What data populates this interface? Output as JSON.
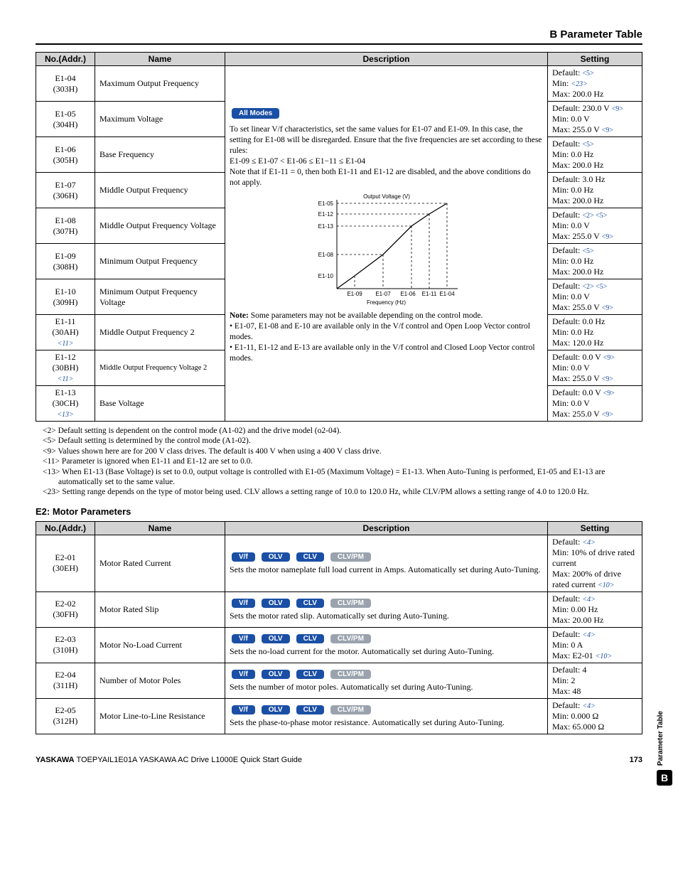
{
  "header": "B  Parameter Table",
  "columns": {
    "c1": "No.(Addr.)",
    "c2": "Name",
    "c3": "Description",
    "c4": "Setting"
  },
  "t1_rows": [
    {
      "addr1": "E1-04",
      "addr2": "(303H)",
      "name": "Maximum Output Frequency",
      "s1": "Default: ",
      "r1": "<5>",
      "s2": "Min: ",
      "r2": "<23>",
      "s3": "Max: 200.0 Hz"
    },
    {
      "addr1": "E1-05",
      "addr2": "(304H)",
      "name": "Maximum Voltage",
      "s1": "Default: 230.0 V ",
      "r1": "<9>",
      "s2": "Min: 0.0 V",
      "s3": "Max: 255.0 V ",
      "r3": "<9>"
    },
    {
      "addr1": "E1-06",
      "addr2": "(305H)",
      "name": "Base Frequency",
      "s1": "Default: ",
      "r1": "<5>",
      "s2": "Min: 0.0 Hz",
      "s3": "Max: 200.0 Hz"
    },
    {
      "addr1": "E1-07",
      "addr2": "(306H)",
      "name": "Middle Output Frequency",
      "s1": "Default: 3.0 Hz",
      "s2": "Min: 0.0 Hz",
      "s3": "Max: 200.0 Hz"
    },
    {
      "addr1": "E1-08",
      "addr2": "(307H)",
      "name": "Middle Output Frequency Voltage",
      "s1": "Default: ",
      "r1": "<2> <5>",
      "s2": "Min: 0.0 V",
      "s3": "Max: 255.0 V ",
      "r3": "<9>"
    },
    {
      "addr1": "E1-09",
      "addr2": "(308H)",
      "name": "Minimum Output Frequency",
      "s1": "Default: ",
      "r1": "<5>",
      "s2": "Min: 0.0 Hz",
      "s3": "Max: 200.0 Hz"
    },
    {
      "addr1": "E1-10",
      "addr2": "(309H)",
      "name": "Minimum Output Frequency Voltage",
      "s1": "Default: ",
      "r1": "<2> <5>",
      "s2": "Min: 0.0 V",
      "s3": "Max: 255.0 V ",
      "r3": "<9>"
    },
    {
      "addr1": "E1-11",
      "addr2": "(30AH)",
      "addr_ref": "<11>",
      "name": "Middle Output Frequency 2",
      "s1": "Default: 0.0 Hz",
      "s2": "Min: 0.0 Hz",
      "s3": "Max: 120.0 Hz"
    },
    {
      "addr1": "E1-12",
      "addr2": "(30BH)",
      "addr_ref": "<11>",
      "name": "Middle Output Frequency Voltage 2",
      "s1": "Default: 0.0 V ",
      "r1": "<9>",
      "s2": "Min: 0.0 V",
      "s3": "Max: 255.0 V ",
      "r3": "<9>"
    },
    {
      "addr1": "E1-13",
      "addr2": "(30CH)",
      "addr_ref": "<13>",
      "name": "Base Voltage",
      "s1": "Default: 0.0 V ",
      "r1": "<9>",
      "s2": "Min: 0.0 V",
      "s3": "Max: 255.0 V ",
      "r3": "<9>"
    }
  ],
  "desc": {
    "badge": "All Modes",
    "p1": "To set linear V/f characteristics, set the same values for E1-07 and E1-09. In this case, the setting for E1-08 will be disregarded. Ensure that the five frequencies are set according to these rules:",
    "eq": "E1-09 ≤ E1-07 < E1-06 ≤ E1−11 ≤ E1-04",
    "p2": "Note that if E1-11 = 0, then both E1-11 and E1-12 are disabled, and the above conditions do not apply.",
    "diag_title": "Output Voltage (V)",
    "diag_y": [
      "E1-05",
      "E1-12",
      "E1-13",
      "E1-08",
      "E1-10"
    ],
    "diag_x": [
      "E1-09",
      "E1-07",
      "E1-06",
      "E1-11",
      "E1-04"
    ],
    "diag_xlabel": "Frequency (Hz)",
    "note_word": "Note:",
    "note_text": " Some parameters may not be available depending on the control mode.",
    "bul1": "E1-07, E1-08 and E-10 are available only in the V/f control and Open Loop Vector control modes.",
    "bul2": "E1-11, E1-12 and E-13 are available only in the V/f control and Closed Loop Vector control modes."
  },
  "footnotes": {
    "f2": "<2> Default setting is dependent on the control mode (A1-02) and the drive model (o2-04).",
    "f5": "<5> Default setting is determined by the control mode (A1-02).",
    "f9": "<9> Values shown here are for 200 V class drives. The default is 400 V when using a 400 V class drive.",
    "f11": "<11> Parameter is ignored when E1-11 and E1-12 are set to 0.0.",
    "f13": "<13> When E1-13 (Base Voltage) is set to 0.0, output voltage is controlled with E1-05 (Maximum Voltage) = E1-13. When Auto-Tuning is performed, E1-05 and E1-13 are automatically set to the same value.",
    "f23": "<23> Setting range depends on the type of motor being used. CLV allows a setting range of 10.0 to 120.0 Hz, while CLV/PM allows a setting range of 4.0 to 120.0 Hz."
  },
  "section2": "E2: Motor Parameters",
  "badges": {
    "vf": "V/f",
    "olv": "OLV",
    "clv": "CLV",
    "clvpm": "CLV/PM"
  },
  "t2_rows": [
    {
      "addr1": "E2-01",
      "addr2": "(30EH)",
      "name": "Motor Rated Current",
      "text": "Sets the motor nameplate full load current in Amps. Automatically set during Auto-Tuning.",
      "s1": "Default: ",
      "r1": "<4>",
      "s2": "Min: 10% of drive rated current",
      "s3": "Max: 200% of drive rated current ",
      "r3": "<10>"
    },
    {
      "addr1": "E2-02",
      "addr2": "(30FH)",
      "name": "Motor Rated Slip",
      "text": "Sets the motor rated slip. Automatically set during Auto-Tuning.",
      "s1": "Default: ",
      "r1": "<4>",
      "s2": "Min: 0.00 Hz",
      "s3": "Max: 20.00 Hz"
    },
    {
      "addr1": "E2-03",
      "addr2": "(310H)",
      "name": "Motor No-Load Current",
      "text": "Sets the no-load current for the motor. Automatically set during Auto-Tuning.",
      "s1": "Default: ",
      "r1": "<4>",
      "s2": "Min: 0 A",
      "s3": "Max: E2-01 ",
      "r3": "<10>"
    },
    {
      "addr1": "E2-04",
      "addr2": "(311H)",
      "name": "Number of Motor Poles",
      "text": "Sets the number of motor poles. Automatically set during Auto-Tuning.",
      "s1": "Default: 4",
      "s2": "Min: 2",
      "s3": "Max: 48"
    },
    {
      "addr1": "E2-05",
      "addr2": "(312H)",
      "name": "Motor Line-to-Line Resistance",
      "text": "Sets the phase-to-phase motor resistance. Automatically set during Auto-Tuning.",
      "s1": "Default: ",
      "r1": "<4>",
      "s2": "Min: 0.000 Ω",
      "s3": "Max: 65.000 Ω"
    }
  ],
  "footer": {
    "left": "YASKAWA",
    "mid": " TOEPYAIL1E01A YASKAWA AC Drive L1000E Quick Start Guide",
    "page": "173"
  },
  "side": {
    "label": "Parameter Table",
    "letter": "B"
  },
  "chart_data": {
    "type": "line",
    "title": "Output Voltage (V)",
    "xlabel": "Frequency (Hz)",
    "ylabel": "Output Voltage (V)",
    "x_points": [
      "E1-09",
      "E1-07",
      "E1-06",
      "E1-11",
      "E1-04"
    ],
    "y_levels": [
      "E1-10",
      "E1-08",
      "E1-13",
      "E1-12",
      "E1-05"
    ],
    "series": [
      {
        "name": "V/f pattern",
        "points": [
          {
            "x": "E1-09",
            "y": "E1-10"
          },
          {
            "x": "E1-07",
            "y": "E1-08"
          },
          {
            "x": "E1-06",
            "y": "E1-13"
          },
          {
            "x": "E1-11",
            "y": "E1-12"
          },
          {
            "x": "E1-04",
            "y": "E1-05"
          }
        ]
      }
    ]
  }
}
